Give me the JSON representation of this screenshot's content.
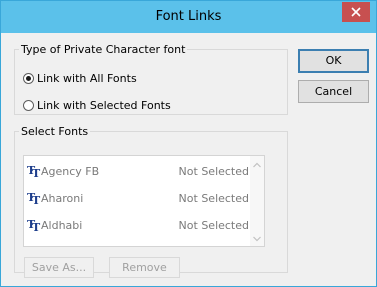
{
  "window": {
    "title": "Font Links"
  },
  "radio_group": {
    "legend": "Type of Private Character font",
    "options": [
      {
        "label": "Link with All Fonts",
        "checked": true
      },
      {
        "label": "Link with Selected Fonts",
        "checked": false
      }
    ]
  },
  "buttons": {
    "ok": "OK",
    "cancel": "Cancel",
    "save_as": "Save As...",
    "remove": "Remove"
  },
  "fonts_group": {
    "legend": "Select Fonts",
    "items": [
      {
        "name": "Agency FB",
        "status": "Not Selected",
        "icon": "truetype-font-icon"
      },
      {
        "name": "Aharoni",
        "status": "Not Selected",
        "icon": "truetype-font-icon"
      },
      {
        "name": "Aldhabi",
        "status": "Not Selected",
        "icon": "truetype-font-icon"
      }
    ]
  },
  "colors": {
    "title_bar": "#5bc1ea",
    "close_button": "#c75050",
    "default_button_border": "#3c7fb1"
  }
}
